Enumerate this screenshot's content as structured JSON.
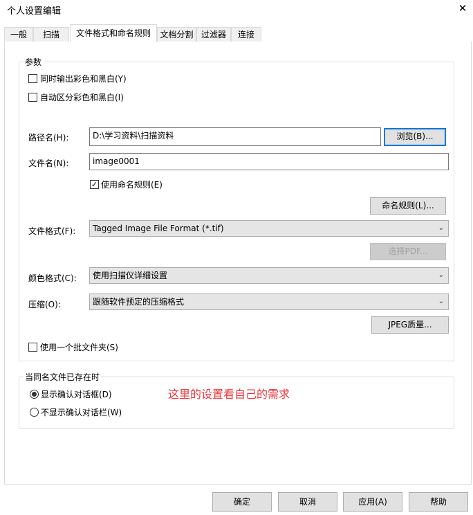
{
  "window": {
    "title": "个人设置编辑",
    "close_glyph": "✕"
  },
  "tabs": [
    "一般",
    "扫描",
    "文件格式和命名规则",
    "文档分割",
    "过滤器",
    "连接"
  ],
  "params": {
    "group_title": "参数",
    "cb_color_bw": "同时输出彩色和黑白(Y)",
    "cb_auto_color": "自动区分彩色和黑白(I)",
    "path_label": "路径名(H):",
    "path_value": "D:\\学习资料\\扫描资料",
    "browse_label": "浏览(B)...",
    "filename_label": "文件名(N):",
    "filename_value": "image0001",
    "cb_naming_rule": "使用命名规则(E)",
    "naming_rule_button": "命名规则(L)...",
    "format_label": "文件格式(F):",
    "format_value": "Tagged Image File Format (*.tif)",
    "select_pdf_button": "选择PDF...",
    "color_label": "颜色格式(C):",
    "color_value": "使用扫描仪详细设置",
    "compression_label": "压缩(O):",
    "compression_value": "跟随软件预定的压缩格式",
    "jpeg_button": "JPEG质量...",
    "cb_batch_folder": "使用一个批文件夹(S)"
  },
  "exists": {
    "group_title": "当同名文件已存在时",
    "radio_show": "显示确认对话框(D)",
    "radio_hide": "不显示确认对话栏(W)",
    "annotation": "这里的设置看自己的需求"
  },
  "footer": {
    "ok": "确定",
    "cancel": "取消",
    "apply": "应用(A)",
    "help": "帮助"
  },
  "icons": {
    "check": "✓",
    "chevron": "⌄"
  }
}
